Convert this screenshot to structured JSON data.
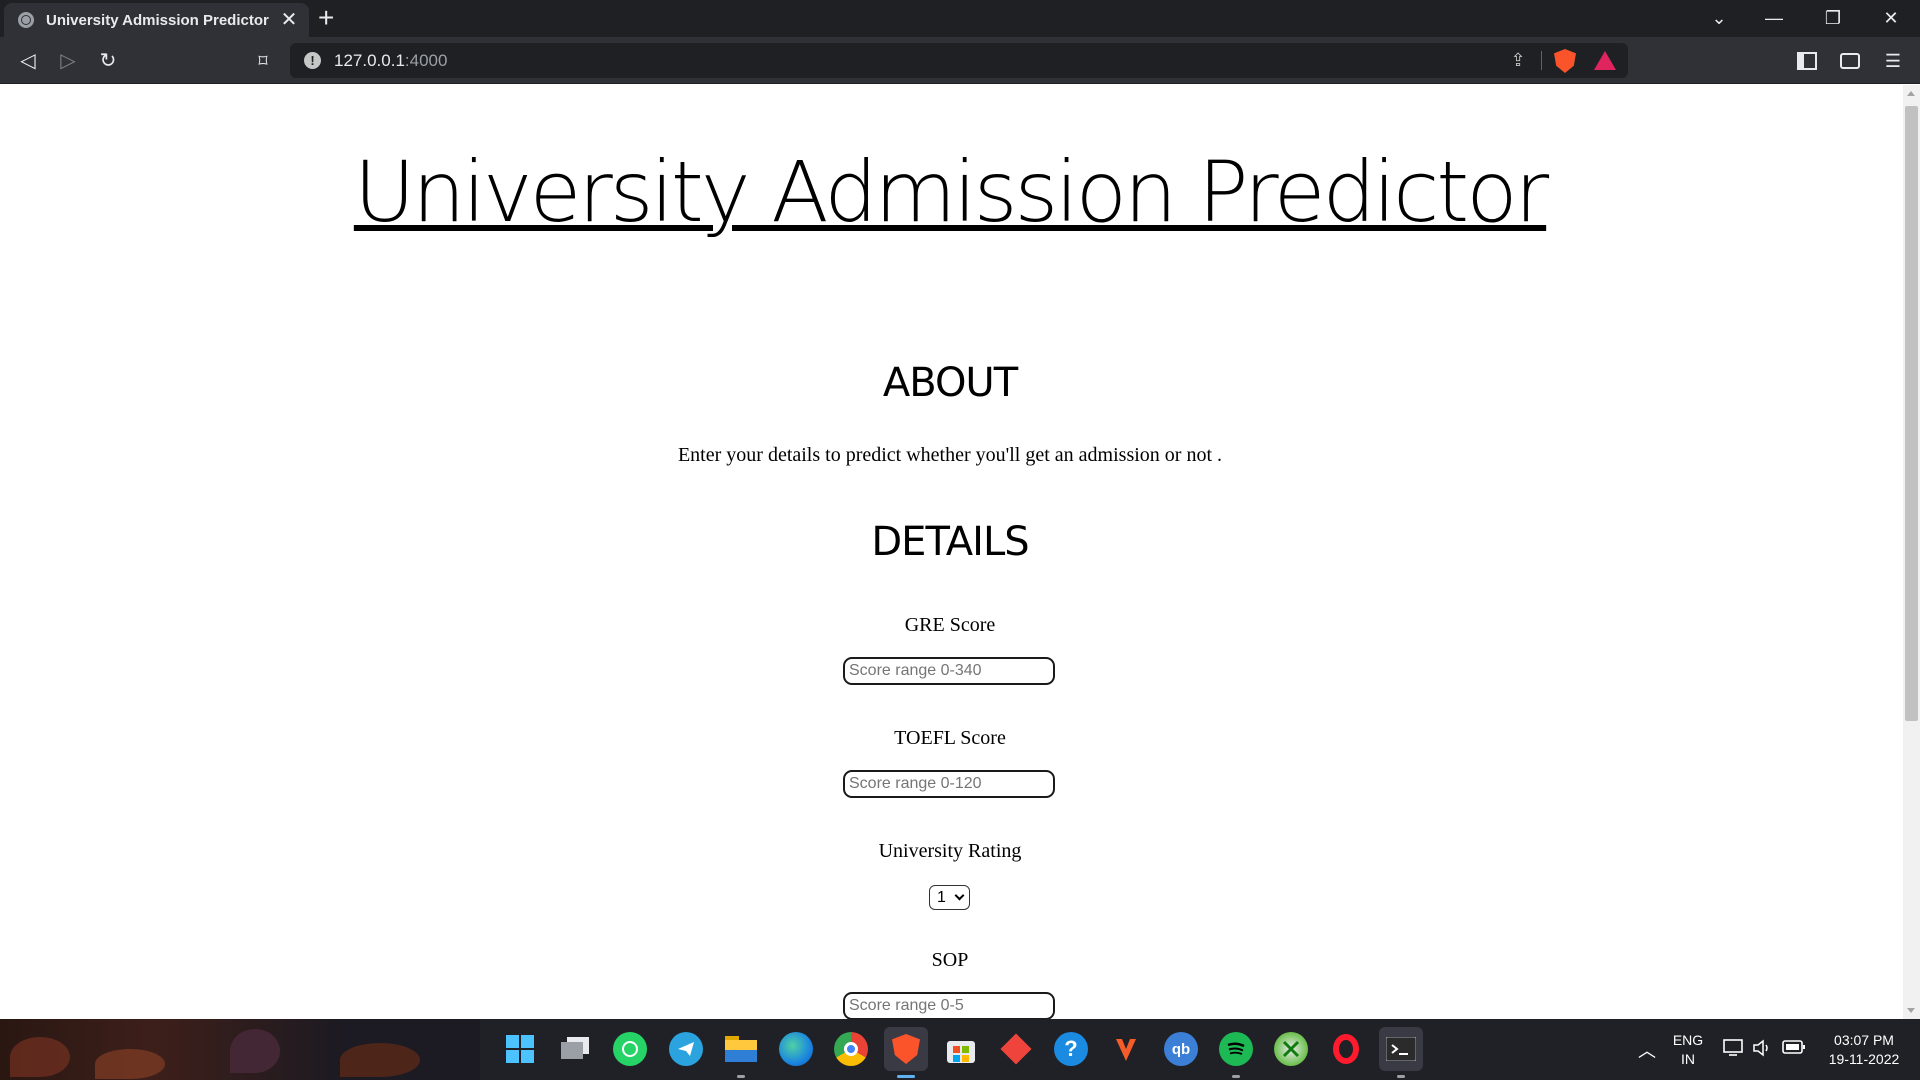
{
  "browser": {
    "tab_title": "University Admission Predictor",
    "tab_close": "✕",
    "new_tab": "+",
    "url_host": "127.0.0.1",
    "url_port": ":4000",
    "window_controls": {
      "tabsearch": "⌄",
      "minimize": "—",
      "restore": "❐",
      "close": "✕"
    }
  },
  "page": {
    "title": "University Admission Predictor",
    "about_heading": "ABOUT",
    "about_text": "Enter your details to predict whether you'll get an admission or not .",
    "details_heading": "DETAILS",
    "fields": {
      "gre": {
        "label": "GRE Score",
        "placeholder": "Score range 0-340",
        "value": ""
      },
      "toefl": {
        "label": "TOEFL Score",
        "placeholder": "Score range 0-120",
        "value": ""
      },
      "rating": {
        "label": "University Rating",
        "selected": "1"
      },
      "sop": {
        "label": "SOP",
        "placeholder": "Score range 0-5",
        "value": ""
      }
    }
  },
  "taskbar": {
    "apps": [
      "start-icon",
      "task-view-icon",
      "whatsapp-icon",
      "telegram-icon",
      "file-explorer-icon",
      "edge-icon",
      "chrome-icon",
      "brave-icon",
      "microsoft-store-icon",
      "anydesk-icon",
      "help-icon",
      "vivaldi-icon",
      "qbittorrent-icon",
      "spotify-icon",
      "xbox-icon",
      "opera-icon",
      "terminal-icon"
    ],
    "qb_label": "qb",
    "help_label": "?",
    "language_top": "ENG",
    "language_bottom": "IN",
    "time": "03:07 PM",
    "date": "19-11-2022"
  },
  "colors": {
    "chrome_dark": "#1e2024",
    "chrome_toolbar": "#2f3136",
    "brave_orange": "#fb542b",
    "page_text": "#000000"
  }
}
